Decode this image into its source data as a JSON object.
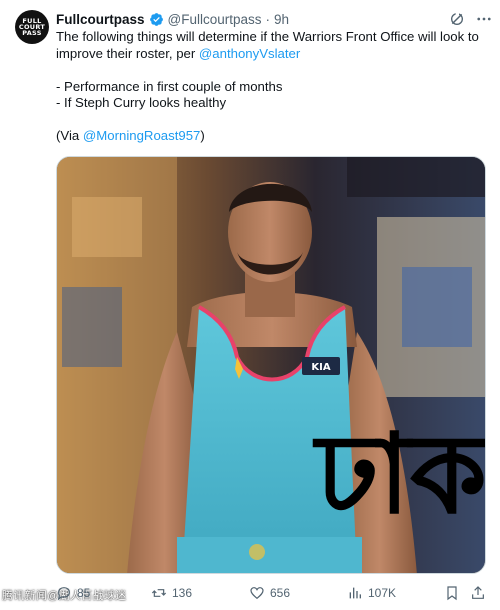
{
  "author": {
    "name": "Fullcourtpass",
    "handle": "@Fullcourtpass",
    "time": "9h",
    "avatar_text": "FULL\nCOURT\nPASS"
  },
  "body": {
    "line1_prefix": "The following things will determine if the Warriors Front Office will look to improve their roster, per ",
    "mention1": "@anthonyVslater",
    "bullet1": "- Performance in first couple of months",
    "bullet2": "- If Steph Curry looks healthy",
    "via_prefix": "(Via ",
    "mention2": "@MorningRoast957",
    "via_suffix": ")"
  },
  "media": {
    "jersey_logo": "KIA",
    "overlay_text": "ঢাক"
  },
  "actions": {
    "replies": "85",
    "retweets": "136",
    "likes": "656",
    "views": "107K"
  },
  "watermark": "腾讯新闻@湖人百战球迷",
  "colors": {
    "link": "#1d9bf0",
    "verified": "#1d9bf0",
    "muted": "#536471",
    "jersey": "#56c1d6"
  },
  "icons": [
    "verified-badge-icon",
    "grok-icon",
    "more-icon",
    "reply-icon",
    "retweet-icon",
    "like-icon",
    "views-icon",
    "bookmark-icon",
    "share-icon"
  ]
}
